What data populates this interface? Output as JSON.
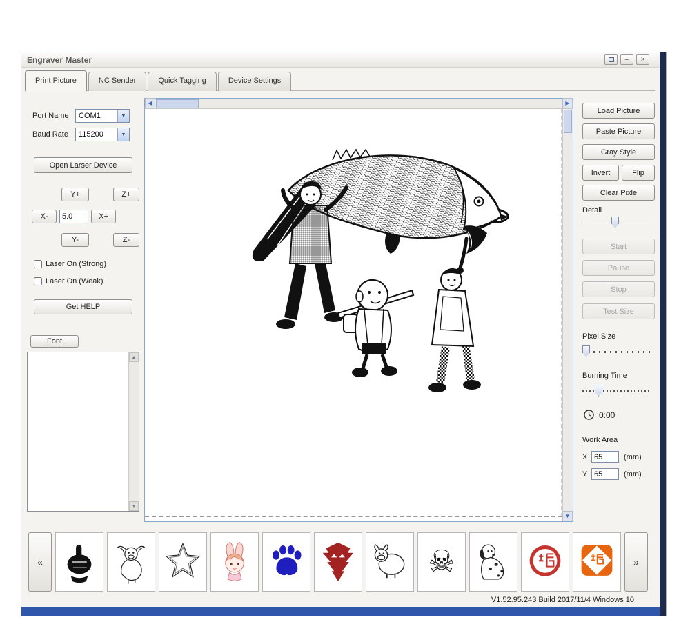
{
  "window": {
    "title": "Engraver Master"
  },
  "icons": {
    "combo_arrow": "▼",
    "scroll_left": "◀",
    "scroll_right": "▶",
    "scroll_up": "▲",
    "scroll_down": "▼",
    "minimize": "–",
    "close": "×",
    "skull": "☠",
    "prev": "«",
    "next": "»"
  },
  "tabs": [
    {
      "label": "Print Picture"
    },
    {
      "label": "NC Sender"
    },
    {
      "label": "Quick Tagging"
    },
    {
      "label": "Device Settings"
    }
  ],
  "connection": {
    "port_label": "Port Name",
    "port_value": "COM1",
    "baud_label": "Baud Rate",
    "baud_value": "115200",
    "open_device": "Open Larser Device"
  },
  "jog": {
    "y_plus": "Y+",
    "z_plus": "Z+",
    "x_minus": "X-",
    "step": "5.0",
    "x_plus": "X+",
    "y_minus": "Y-",
    "z_minus": "Z-"
  },
  "laser": {
    "strong": "Laser On (Strong)",
    "weak": "Laser On (Weak)"
  },
  "help_button": "Get HELP",
  "font_button": "Font",
  "canvas": {
    "artwork_name": "cartoon-figures-carrying-giant-fish"
  },
  "picture_tools": {
    "load": "Load Picture",
    "paste": "Paste Picture",
    "gray": "Gray Style",
    "invert": "Invert",
    "flip": "Flip",
    "clear": "Clear Pixle"
  },
  "detail": {
    "label": "Detail"
  },
  "job_controls": {
    "start": "Start",
    "pause": "Pause",
    "stop": "Stop",
    "test": "Test Size"
  },
  "pixel_size": {
    "label": "Pixel Size"
  },
  "burning_time": {
    "label": "Burning Time",
    "time": "0:00"
  },
  "work_area": {
    "label": "Work Area",
    "x_label": "X",
    "x_value": "65",
    "x_unit": "(mm)",
    "y_label": "Y",
    "y_value": "65",
    "y_unit": "(mm)"
  },
  "gallery": {
    "items": [
      {
        "name": "pointing-hand"
      },
      {
        "name": "ox-sketch"
      },
      {
        "name": "star-sketch"
      },
      {
        "name": "bunny-girl"
      },
      {
        "name": "paw-print"
      },
      {
        "name": "autobot-logo"
      },
      {
        "name": "cow-doodle"
      },
      {
        "name": "skull-crossbones"
      },
      {
        "name": "dalmatian-dog"
      },
      {
        "name": "fu-seal-round"
      },
      {
        "name": "fu-seal-square"
      }
    ]
  },
  "status_bar": {
    "version": "V1.52.95.243 Build 2017/11/4 Windows 10"
  },
  "colors": {
    "accent_blue": "#2e56ab",
    "navy_edge": "#1c2b4e",
    "scroll_arrow": "#3a66c8",
    "paw_blue": "#1f1fbf",
    "autobot_red": "#a32222",
    "seal_red": "#c6342e",
    "seal_orange": "#e8650f"
  }
}
